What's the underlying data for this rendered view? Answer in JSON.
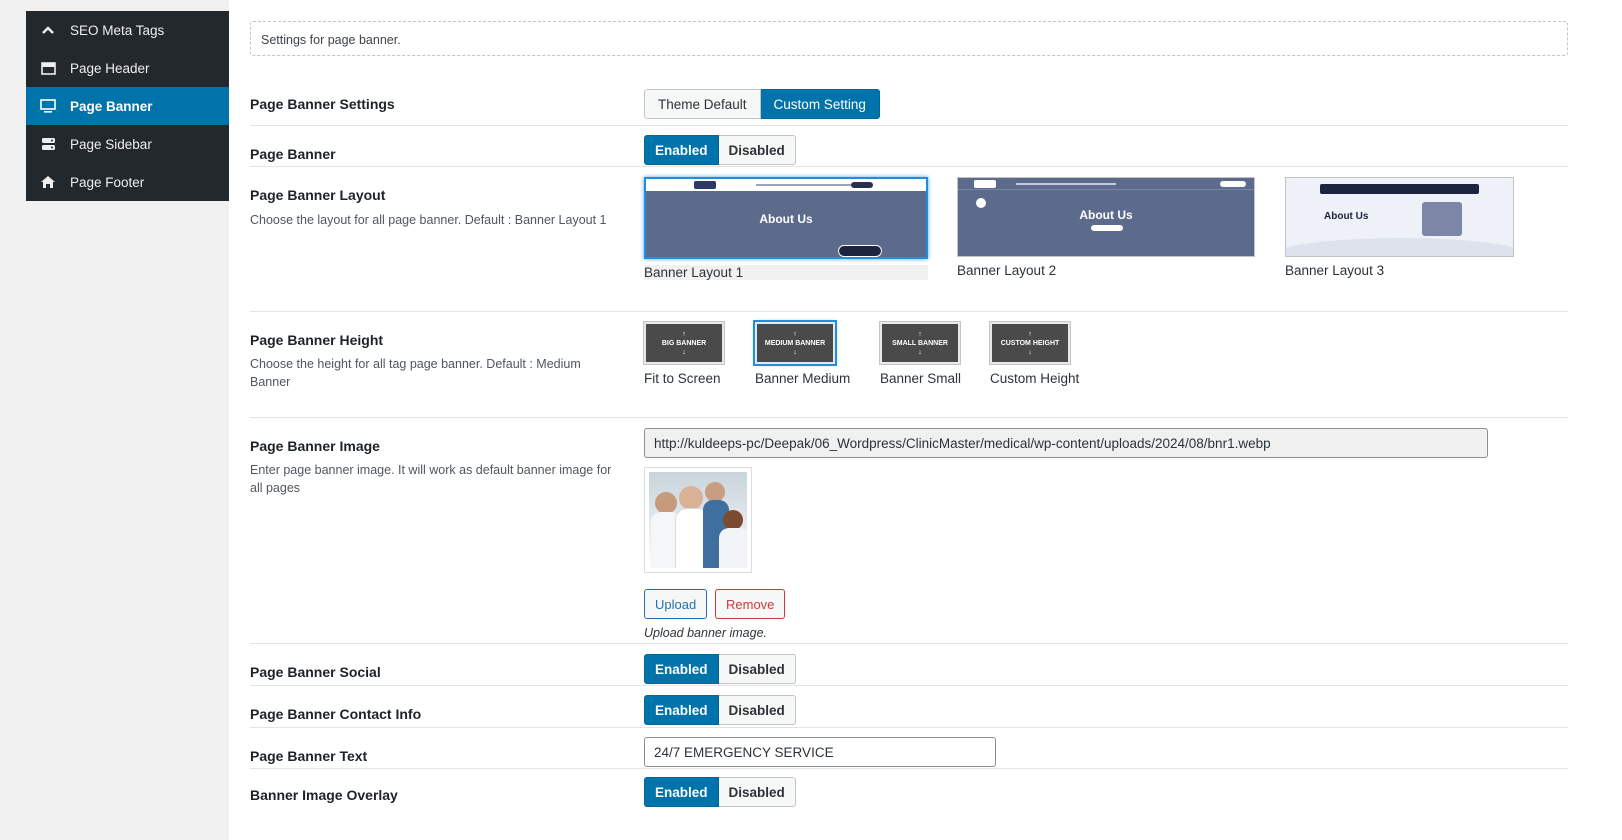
{
  "sidebar": {
    "items": [
      {
        "label": "SEO Meta Tags",
        "icon": "chevron-up-icon",
        "active": false
      },
      {
        "label": "Page Header",
        "icon": "window-icon",
        "active": false
      },
      {
        "label": "Page Banner",
        "icon": "monitor-icon",
        "active": true
      },
      {
        "label": "Page Sidebar",
        "icon": "server-icon",
        "active": false
      },
      {
        "label": "Page Footer",
        "icon": "home-icon",
        "active": false
      }
    ]
  },
  "intro": "Settings for page banner.",
  "banner_settings": {
    "label": "Page Banner Settings",
    "options": [
      "Theme Default",
      "Custom Setting"
    ],
    "selected": "Custom Setting"
  },
  "page_banner": {
    "label": "Page Banner",
    "on": "Enabled",
    "off": "Disabled",
    "value": "Enabled"
  },
  "layout": {
    "label": "Page Banner Layout",
    "desc": "Choose the layout for all page banner. Default : Banner Layout 1",
    "options": [
      {
        "caption": "Banner Layout 1",
        "title": "About Us",
        "selected": true
      },
      {
        "caption": "Banner Layout 2",
        "title": "About Us",
        "selected": false
      },
      {
        "caption": "Banner Layout 3",
        "title": "About Us",
        "selected": false
      }
    ]
  },
  "height": {
    "label": "Page Banner Height",
    "desc": "Choose the height for all tag page banner. Default : Medium Banner",
    "options": [
      {
        "img_text": "BIG BANNER",
        "caption": "Fit to Screen",
        "selected": false
      },
      {
        "img_text": "MEDIUM BANNER",
        "caption": "Banner Medium",
        "selected": true
      },
      {
        "img_text": "SMALL BANNER",
        "caption": "Banner Small",
        "selected": false
      },
      {
        "img_text": "CUSTOM HEIGHT",
        "caption": "Custom Height",
        "selected": false
      }
    ]
  },
  "image": {
    "label": "Page Banner Image",
    "desc": "Enter page banner image. It will work as default banner image for all pages",
    "url": "http://kuldeeps-pc/Deepak/06_Wordpress/ClinicMaster/medical/wp-content/uploads/2024/08/bnr1.webp",
    "upload_label": "Upload",
    "remove_label": "Remove",
    "hint": "Upload banner image."
  },
  "social": {
    "label": "Page Banner Social",
    "on": "Enabled",
    "off": "Disabled",
    "value": "Enabled"
  },
  "contact": {
    "label": "Page Banner Contact Info",
    "on": "Enabled",
    "off": "Disabled",
    "value": "Enabled"
  },
  "text": {
    "label": "Page Banner Text",
    "value": "24/7 EMERGENCY SERVICE"
  },
  "overlay": {
    "label": "Banner Image Overlay",
    "on": "Enabled",
    "off": "Disabled",
    "value": "Enabled"
  },
  "colors": {
    "accent": "#0073aa",
    "sidebar_bg": "#23282d",
    "remove": "#d63638",
    "upload": "#2271b1"
  }
}
